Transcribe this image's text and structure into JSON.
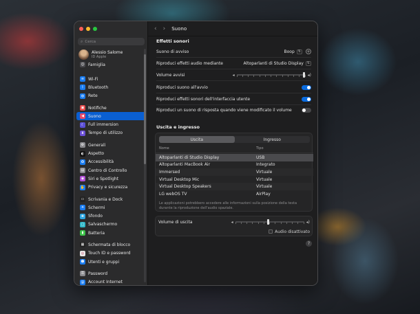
{
  "sidebar": {
    "search_placeholder": "Cerca",
    "account": {
      "name": "Alessio Salome",
      "subtitle": "ID Apple"
    },
    "family": "Famiglia",
    "items": [
      {
        "label": "Wi-Fi",
        "color": "#1a7cf0",
        "icon": "wifi-icon",
        "glyph": "≋"
      },
      {
        "label": "Bluetooth",
        "color": "#1a7cf0",
        "icon": "bluetooth-icon",
        "glyph": "ᛒ"
      },
      {
        "label": "Rete",
        "color": "#1a7cf0",
        "icon": "globe-icon",
        "glyph": "◍"
      },
      {
        "gap": true
      },
      {
        "label": "Notifiche",
        "color": "#e84a4a",
        "icon": "bell-icon",
        "glyph": "▣"
      },
      {
        "label": "Suono",
        "color": "#e84a6a",
        "icon": "speaker-icon",
        "glyph": "◀",
        "selected": true
      },
      {
        "label": "Full immersion",
        "color": "#5b4fd6",
        "icon": "moon-icon",
        "glyph": "☾"
      },
      {
        "label": "Tempo di utilizzo",
        "color": "#6a4fd6",
        "icon": "hourglass-icon",
        "glyph": "⧗"
      },
      {
        "gap": true
      },
      {
        "label": "Generali",
        "color": "#8a8a8e",
        "icon": "gear-icon",
        "glyph": "⚙"
      },
      {
        "label": "Aspetto",
        "color": "#111111",
        "icon": "appearance-icon",
        "glyph": "◐"
      },
      {
        "label": "Accessibilità",
        "color": "#1a7cf0",
        "icon": "accessibility-icon",
        "glyph": "✪"
      },
      {
        "label": "Centro di Controllo",
        "color": "#8a8a8e",
        "icon": "control-center-icon",
        "glyph": "▤"
      },
      {
        "label": "Siri e Spotlight",
        "color": "#b04fd6",
        "icon": "siri-icon",
        "glyph": "◉"
      },
      {
        "label": "Privacy e sicurezza",
        "color": "#1a7cf0",
        "icon": "hand-icon",
        "glyph": "✋"
      },
      {
        "gap": true
      },
      {
        "label": "Scrivania e Dock",
        "color": "#222222",
        "icon": "dock-icon",
        "glyph": "▭"
      },
      {
        "label": "Schermi",
        "color": "#1a7cf0",
        "icon": "display-icon",
        "glyph": "✳"
      },
      {
        "label": "Sfondo",
        "color": "#2fa6e0",
        "icon": "wallpaper-icon",
        "glyph": "❀"
      },
      {
        "label": "Salvaschermo",
        "color": "#2fb8c8",
        "icon": "screensaver-icon",
        "glyph": "▢"
      },
      {
        "label": "Batteria",
        "color": "#3ec24a",
        "icon": "battery-icon",
        "glyph": "▮"
      },
      {
        "gap": true
      },
      {
        "label": "Schermata di blocco",
        "color": "#222222",
        "icon": "lock-screen-icon",
        "glyph": "▦"
      },
      {
        "label": "Touch ID e password",
        "color": "#e8e8e8",
        "icon": "fingerprint-icon",
        "glyph": "◎"
      },
      {
        "label": "Utenti e gruppi",
        "color": "#1a7cf0",
        "icon": "users-icon",
        "glyph": "☻"
      },
      {
        "gap": true
      },
      {
        "label": "Password",
        "color": "#8a8a8e",
        "icon": "key-icon",
        "glyph": "⚿"
      },
      {
        "label": "Account Internet",
        "color": "#1a7cf0",
        "icon": "at-icon",
        "glyph": "@"
      }
    ]
  },
  "main": {
    "title": "Suono",
    "effects": {
      "section_title": "Effetti sonori",
      "alert_sound_label": "Suono di avviso",
      "alert_sound_value": "Boop",
      "play_via_label": "Riproduci effetti audio mediante",
      "play_via_value": "Altoparlanti di Studio Display",
      "alert_volume_label": "Volume avvisi",
      "alert_volume_level": 0.98,
      "startup_label": "Riproduci suono all'avvio",
      "startup_on": true,
      "ui_sounds_label": "Riproduci effetti sonori dell'interfaccia utente",
      "ui_sounds_on": true,
      "feedback_label": "Riproduci un suono di risposta quando viene modificato il volume",
      "feedback_on": false
    },
    "io": {
      "section_title": "Uscita e ingresso",
      "tab_output": "Uscita",
      "tab_input": "Ingresso",
      "col_name": "Nome",
      "col_type": "Tipo",
      "rows": [
        {
          "name": "Altoparlanti di Studio Display",
          "type": "USB",
          "selected": true
        },
        {
          "name": "Altoparlanti MacBook Air",
          "type": "Integrato"
        },
        {
          "name": "Immersed",
          "type": "Virtuale"
        },
        {
          "name": "Virtual Desktop Mic",
          "type": "Virtuale"
        },
        {
          "name": "Virtual Desktop Speakers",
          "type": "Virtuale"
        },
        {
          "name": "LG webOS TV",
          "type": "AirPlay"
        }
      ],
      "note": "Le applicazioni potrebbero accedere alle informazioni sulla posizione della testa durante la riproduzione dell'audio spaziale."
    },
    "output_volume_label": "Volume di uscita",
    "output_volume_level": 0.48,
    "mute_label": "Audio disattivato",
    "help_label": "?"
  }
}
